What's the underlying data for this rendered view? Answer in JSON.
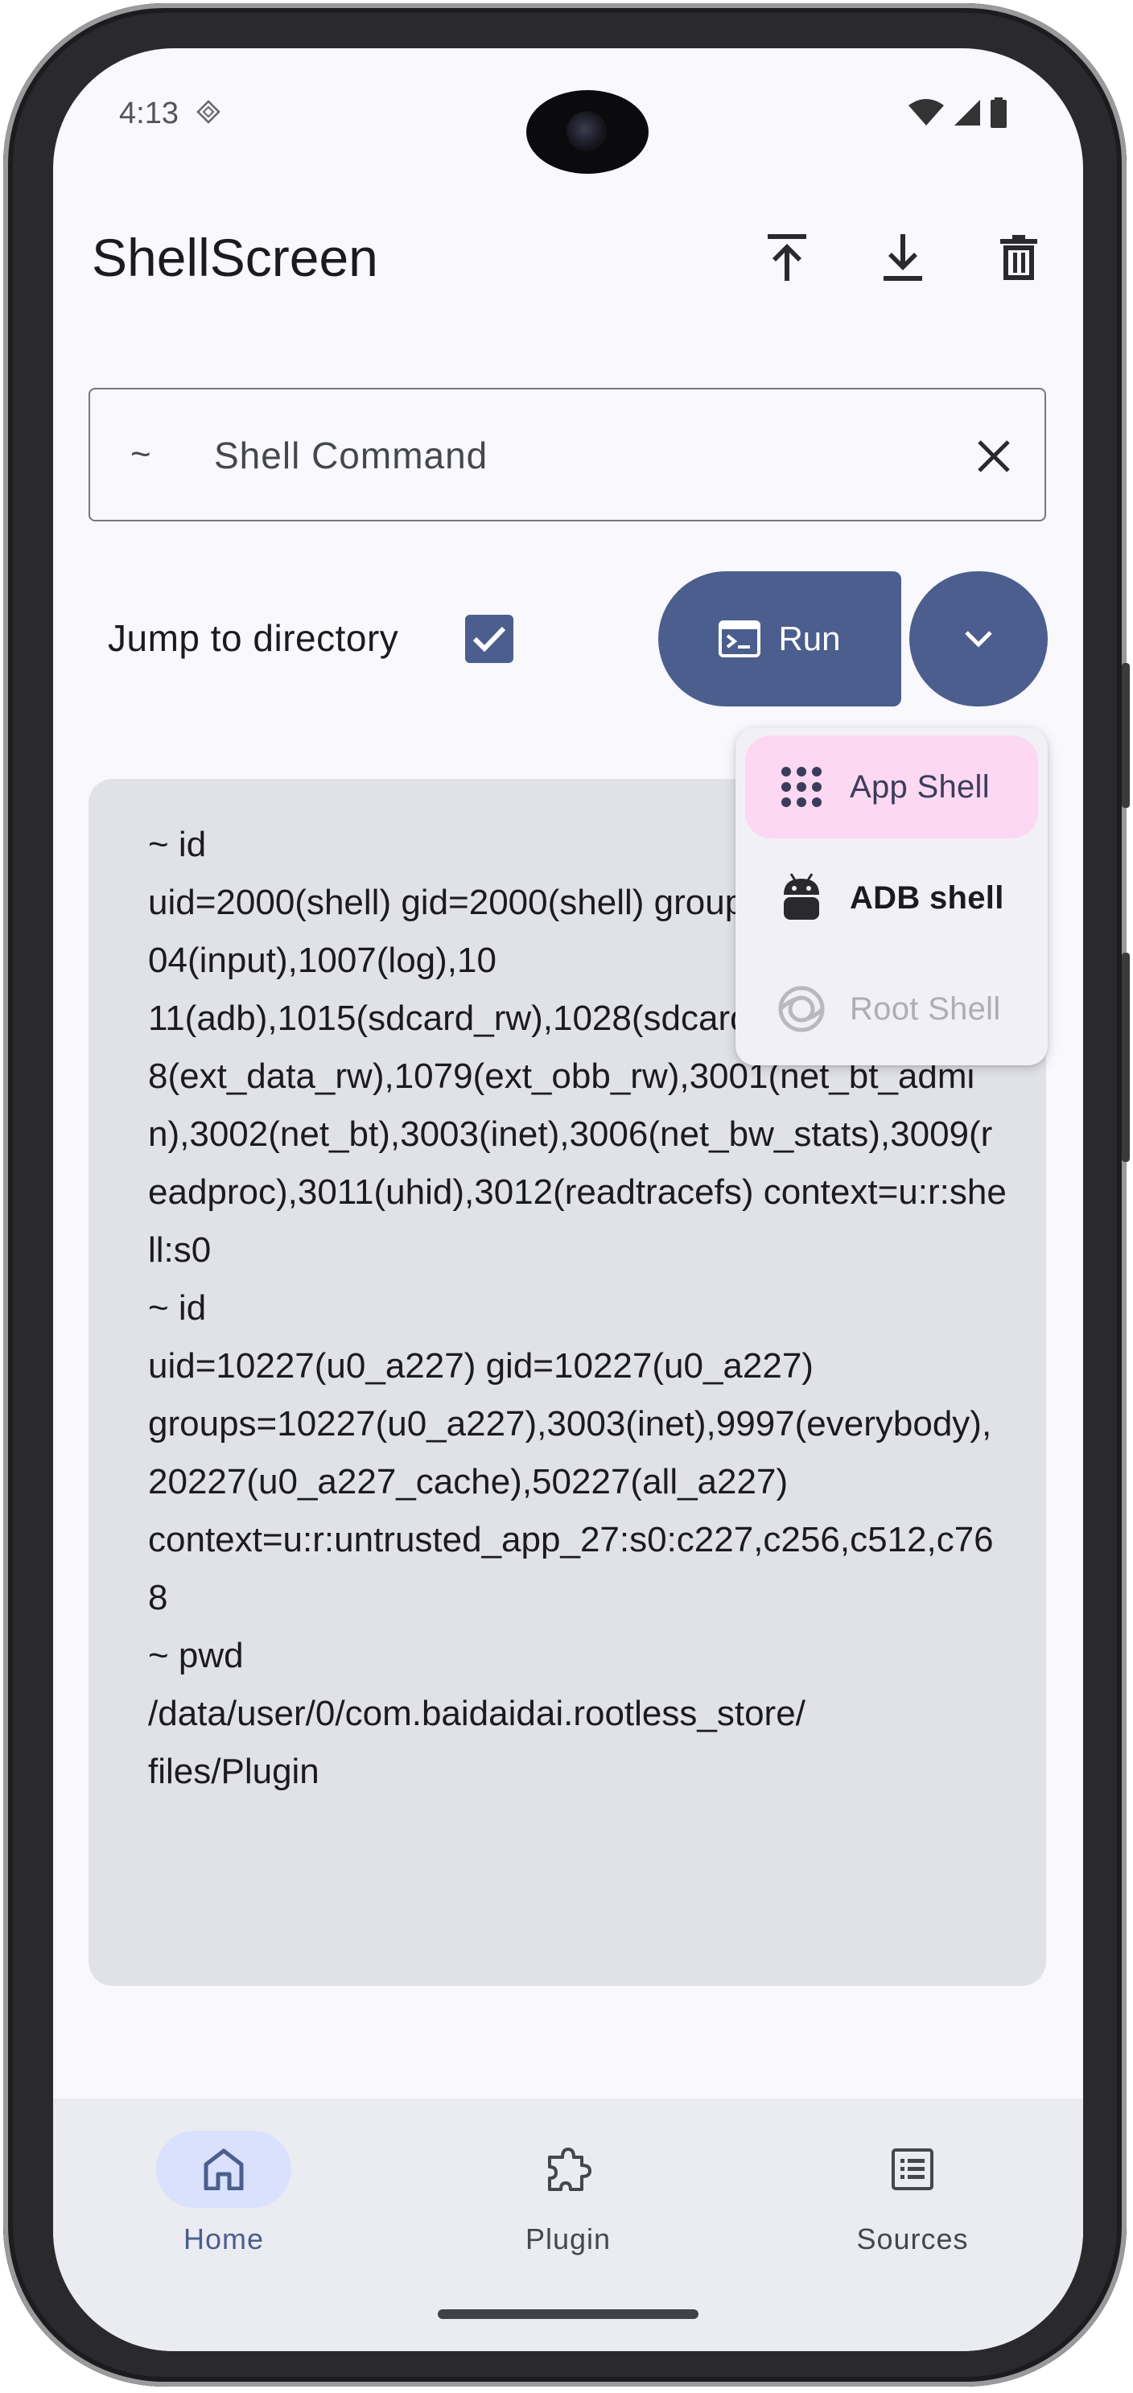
{
  "status_bar": {
    "time": "4:13",
    "icons": [
      "diamond-notification-icon",
      "wifi-icon",
      "signal-icon",
      "battery-icon"
    ]
  },
  "app_bar": {
    "title": "ShellScreen",
    "actions": [
      "upload-icon",
      "download-icon",
      "trash-icon"
    ]
  },
  "command": {
    "prefix": "~",
    "placeholder": "Shell Command",
    "value": ""
  },
  "jump": {
    "label": "Jump to directory",
    "checked": true
  },
  "run": {
    "label": "Run"
  },
  "shell_menu": {
    "items": [
      {
        "label": "App Shell",
        "icon": "apps-grid-icon",
        "state": "selected"
      },
      {
        "label": "ADB shell",
        "icon": "android-icon",
        "state": "normal"
      },
      {
        "label": "Root Shell",
        "icon": "root-swirl-icon",
        "state": "disabled"
      }
    ]
  },
  "output": {
    "text": "~ id\nuid=2000(shell) gid=2000(shell) groups=2000(shell),1004(input),1007(log),10\n11(adb),1015(sdcard_rw),1028(sdcard_r),107\n8(ext_data_rw),1079(ext_obb_rw),3001(net_bt_admin),3002(net_bt),3003(inet),3006(net_bw_stats),3009(readproc),3011(uhid),3012(readtracefs) context=u:r:shell:s0\n~ id\nuid=10227(u0_a227) gid=10227(u0_a227)\ngroups=10227(u0_a227),3003(inet),9997(everybody),20227(u0_a227_cache),50227(all_a227)\ncontext=u:r:untrusted_app_27:s0:c227,c256,c512,c768\n~ pwd\n/data/user/0/com.baidaidai.rootless_store/\nfiles/Plugin"
  },
  "bottom_nav": {
    "items": [
      {
        "label": "Home",
        "icon": "home-icon",
        "active": true
      },
      {
        "label": "Plugin",
        "icon": "puzzle-icon",
        "active": false
      },
      {
        "label": "Sources",
        "icon": "list-icon",
        "active": false
      }
    ]
  },
  "colors": {
    "primary": "#4b5e8d",
    "surface": "#f8f8fd",
    "output_bg": "#e1e2e8",
    "menu_selected": "#fcd8f2",
    "nav_active_pill": "#dae1fd"
  }
}
